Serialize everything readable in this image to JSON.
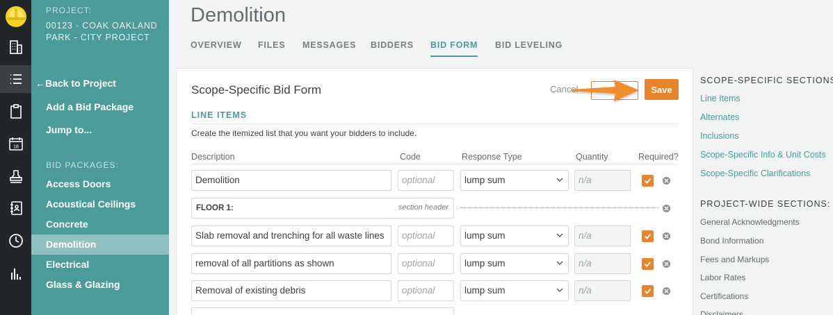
{
  "icons": {
    "logo": "hard-hat-icon",
    "rail": [
      "building-icon",
      "list-icon",
      "clipboard-icon",
      "calendar-icon",
      "stamp-icon",
      "address-book-icon",
      "clock-icon",
      "bar-chart-icon"
    ]
  },
  "calendar_day": "18",
  "project": {
    "label": "PROJECT:",
    "name": "00123 - COAK OAKLAND PARK - CITY PROJECT"
  },
  "sidebar": {
    "back": "Back to Project",
    "add_package": "Add a Bid Package",
    "jump_to": "Jump to...",
    "packages_label": "BID PACKAGES:",
    "packages": [
      "Access Doors",
      "Acoustical Ceilings",
      "Concrete",
      "Demolition",
      "Electrical",
      "Glass & Glazing"
    ],
    "active_package": "Demolition"
  },
  "page": {
    "title": "Demolition",
    "tabs": [
      "OVERVIEW",
      "FILES",
      "MESSAGES",
      "BIDDERS",
      "BID FORM",
      "BID LEVELING"
    ],
    "active_tab": "BID FORM"
  },
  "form": {
    "title": "Scope-Specific Bid Form",
    "cancel": "Cancel",
    "save": "Save",
    "section_title": "LINE ITEMS",
    "hint": "Create the itemized list that you want your bidders to include.",
    "columns": {
      "description": "Description",
      "code": "Code",
      "response_type": "Response Type",
      "quantity": "Quantity",
      "required": "Required?"
    },
    "code_placeholder": "optional",
    "quantity_placeholder": "n/a",
    "rows": [
      {
        "description": "Demolition",
        "response": "lump sum",
        "required": true
      },
      {
        "section": "FLOOR 1:",
        "tag": "section header"
      },
      {
        "description": "Slab removal and trenching for all waste lines",
        "response": "lump sum",
        "required": true
      },
      {
        "description": "removal of all partitions as shown",
        "response": "lump sum",
        "required": true
      },
      {
        "description": "Removal of existing debris",
        "response": "lump sum",
        "required": true
      }
    ]
  },
  "right_panel": {
    "scope_heading": "SCOPE-SPECIFIC SECTIONS",
    "scope_links": [
      "Line Items",
      "Alternates",
      "Inclusions",
      "Scope-Specific Info & Unit Costs",
      "Scope-Specific Clarifications"
    ],
    "project_heading": "PROJECT-WIDE SECTIONS:",
    "project_items": [
      "General Acknowledgments",
      "Bond Information",
      "Fees and Markups",
      "Labor Rates",
      "Certifications",
      "Disclaimers"
    ]
  },
  "colors": {
    "teal": "#4a9b9a",
    "orange": "#e6832b",
    "rail": "#232628"
  }
}
